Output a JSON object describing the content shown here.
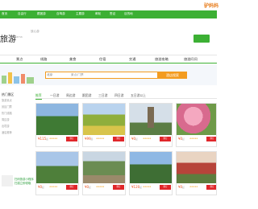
{
  "header": {
    "logo_text": "驴妈妈"
  },
  "nav": {
    "items": [
      "首页",
      "自由行",
      "跟团游",
      "自驾游",
      "主题游",
      "邮轮",
      "签证",
      "目的地"
    ]
  },
  "brand": {
    "name": "旅游",
    "sub": "lvmama",
    "tag": "放心游"
  },
  "tabs": [
    "景点",
    "线路",
    "美食",
    "住宿",
    "交通",
    "旅游攻略",
    "旅游问问"
  ],
  "search": {
    "city": "北京",
    "keyword": "景点/门票",
    "button": "酒店搜索"
  },
  "sidebar": {
    "title": "热门景区",
    "links": [
      "旅游景点",
      "景区门票",
      "热门线路",
      "周边游",
      "出境游",
      "酒店推荐"
    ],
    "qr_line1": "扫码旅游小程序",
    "qr_line2": "扫描立即领取"
  },
  "filters": [
    "推荐",
    "一日游",
    "周边游",
    "跟团游",
    "三日游",
    "四日游",
    "五日游以上"
  ],
  "cards": [
    {
      "price": "¥115",
      "unit": "起"
    },
    {
      "price": "¥99",
      "unit": "起"
    },
    {
      "price": "¥0",
      "unit": "起"
    },
    {
      "price": "¥0",
      "unit": "起"
    },
    {
      "price": "¥0",
      "unit": "起"
    },
    {
      "price": "¥0",
      "unit": "起"
    },
    {
      "price": "¥120",
      "unit": "起"
    },
    {
      "price": "¥0",
      "unit": "起"
    }
  ],
  "card_buy_label": "预订",
  "colors": {
    "brand_green": "#3cb034",
    "accent_orange": "#f39c1f",
    "price_red": "#f0501e"
  }
}
